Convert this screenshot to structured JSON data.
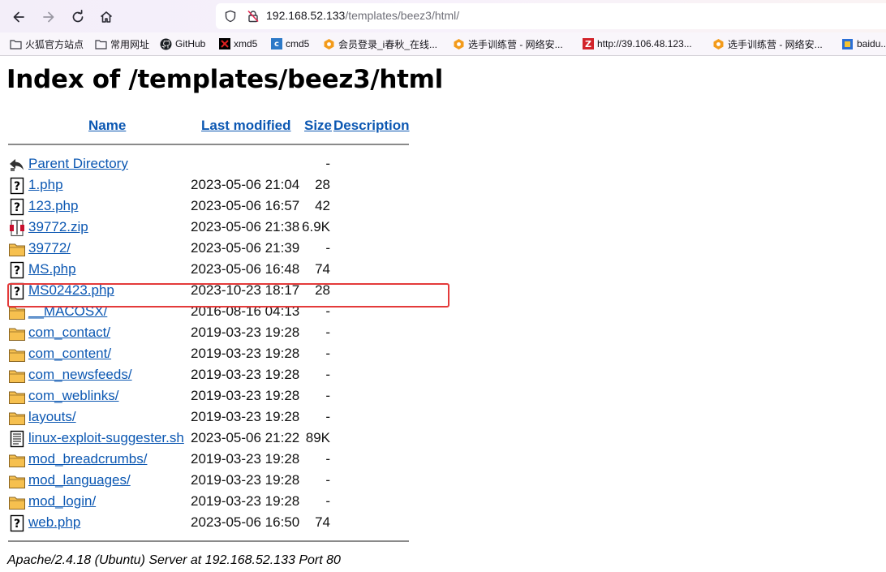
{
  "browser": {
    "url_host": "192.168.52.133",
    "url_path": "/templates/beez3/html/",
    "bookmarks": [
      {
        "label": "火狐官方站点",
        "icon": "folder-icon"
      },
      {
        "label": "常用网址",
        "icon": "folder-icon"
      },
      {
        "label": "GitHub",
        "icon": "github-icon"
      },
      {
        "label": "xmd5",
        "icon": "xmd5-icon"
      },
      {
        "label": "cmd5",
        "icon": "cmd5-icon"
      },
      {
        "label": "会员登录_i春秋_在线...",
        "icon": "ichunqiu-icon"
      },
      {
        "label": "选手训练营 - 网络安...",
        "icon": "ichunqiu-icon"
      },
      {
        "label": "http://39.106.48.123...",
        "icon": "z-icon"
      },
      {
        "label": "选手训练营 - 网络安...",
        "icon": "ichunqiu-icon"
      },
      {
        "label": "baidu...",
        "icon": "baidu-icon"
      }
    ]
  },
  "page": {
    "title": "Index of /templates/beez3/html",
    "headers": {
      "name": "Name",
      "last_modified": "Last modified",
      "size": "Size",
      "description": "Description"
    },
    "entries": [
      {
        "name": "Parent Directory",
        "date": "",
        "size": "-",
        "icon": "back-icon"
      },
      {
        "name": "1.php",
        "date": "2023-05-06 21:04",
        "size": "28",
        "icon": "unknown-file-icon"
      },
      {
        "name": "123.php",
        "date": "2023-05-06 16:57",
        "size": "42",
        "icon": "unknown-file-icon"
      },
      {
        "name": "39772.zip",
        "date": "2023-05-06 21:38",
        "size": "6.9K",
        "icon": "compressed-file-icon"
      },
      {
        "name": "39772/",
        "date": "2023-05-06 21:39",
        "size": "-",
        "icon": "folder-icon"
      },
      {
        "name": "MS.php",
        "date": "2023-05-06 16:48",
        "size": "74",
        "icon": "unknown-file-icon"
      },
      {
        "name": "MS02423.php",
        "date": "2023-10-23 18:17",
        "size": "28",
        "icon": "unknown-file-icon"
      },
      {
        "name": "__MACOSX/",
        "date": "2016-08-16 04:13",
        "size": "-",
        "icon": "folder-icon"
      },
      {
        "name": "com_contact/",
        "date": "2019-03-23 19:28",
        "size": "-",
        "icon": "folder-icon"
      },
      {
        "name": "com_content/",
        "date": "2019-03-23 19:28",
        "size": "-",
        "icon": "folder-icon"
      },
      {
        "name": "com_newsfeeds/",
        "date": "2019-03-23 19:28",
        "size": "-",
        "icon": "folder-icon"
      },
      {
        "name": "com_weblinks/",
        "date": "2019-03-23 19:28",
        "size": "-",
        "icon": "folder-icon"
      },
      {
        "name": "layouts/",
        "date": "2019-03-23 19:28",
        "size": "-",
        "icon": "folder-icon"
      },
      {
        "name": "linux-exploit-suggester.sh",
        "date": "2023-05-06 21:22",
        "size": "89K",
        "icon": "text-file-icon"
      },
      {
        "name": "mod_breadcrumbs/",
        "date": "2019-03-23 19:28",
        "size": "-",
        "icon": "folder-icon"
      },
      {
        "name": "mod_languages/",
        "date": "2019-03-23 19:28",
        "size": "-",
        "icon": "folder-icon"
      },
      {
        "name": "mod_login/",
        "date": "2019-03-23 19:28",
        "size": "-",
        "icon": "folder-icon"
      },
      {
        "name": "web.php",
        "date": "2023-05-06 16:50",
        "size": "74",
        "icon": "unknown-file-icon"
      }
    ],
    "server_signature": "Apache/2.4.18 (Ubuntu) Server at 192.168.52.133 Port 80"
  },
  "colors": {
    "link": "#0b57b2",
    "highlight_box": "#e43a3a"
  }
}
